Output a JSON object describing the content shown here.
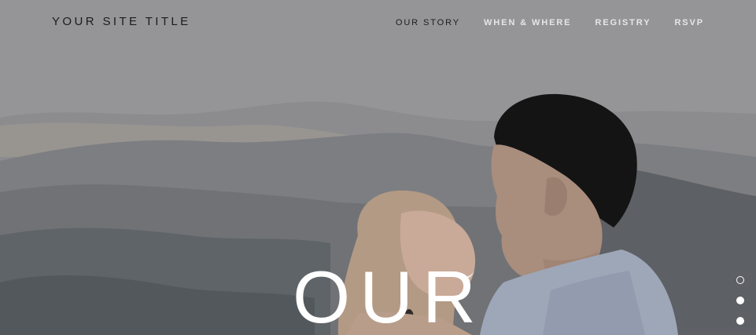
{
  "header": {
    "site_title": "YOUR SITE TITLE"
  },
  "nav": {
    "items": [
      {
        "label": "OUR STORY",
        "active": true
      },
      {
        "label": "WHEN & WHERE",
        "active": false
      },
      {
        "label": "REGISTRY",
        "active": false
      },
      {
        "label": "RSVP",
        "active": false
      }
    ]
  },
  "hero": {
    "headline": "OUR"
  },
  "slider": {
    "dots": [
      {
        "state": "current"
      },
      {
        "state": "other"
      },
      {
        "state": "other"
      }
    ]
  },
  "colors": {
    "overlay": "#8f8f91",
    "title_text": "#1c1c1e",
    "nav_inactive": "#e6e6e8",
    "headline": "#ffffff"
  }
}
